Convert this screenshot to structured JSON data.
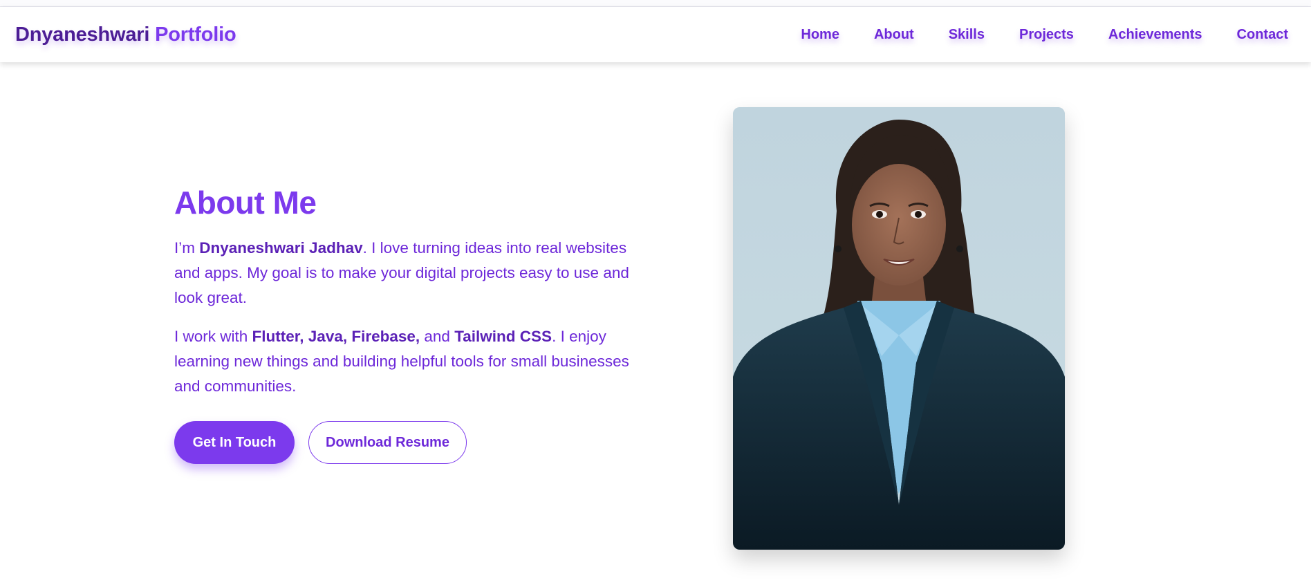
{
  "navbar": {
    "brand_name": "Dnyaneshwari",
    "brand_suffix": "Portfolio",
    "links": [
      "Home",
      "About",
      "Skills",
      "Projects",
      "Achievements",
      "Contact"
    ]
  },
  "about": {
    "heading": "About Me",
    "p1": {
      "prefix": "I’m ",
      "name": "Dnyaneshwari Jadhav",
      "suffix": ". I love turning ideas into real websites and apps. My goal is to make your digital projects easy to use and look great."
    },
    "p2": {
      "prefix": "I work with ",
      "skills": "Flutter, Java, Firebase,",
      "mid": " and ",
      "skill_last": "Tailwind CSS",
      "suffix": ". I enjoy learning new things and building helpful tools for small businesses and communities."
    },
    "buttons": {
      "primary": "Get In Touch",
      "secondary": "Download Resume"
    }
  },
  "colors": {
    "accent": "#7c3aed",
    "brand_dark": "#4c1d95",
    "text": "#6d28d9"
  },
  "photo": {
    "alt_icon": "profile-photo"
  }
}
